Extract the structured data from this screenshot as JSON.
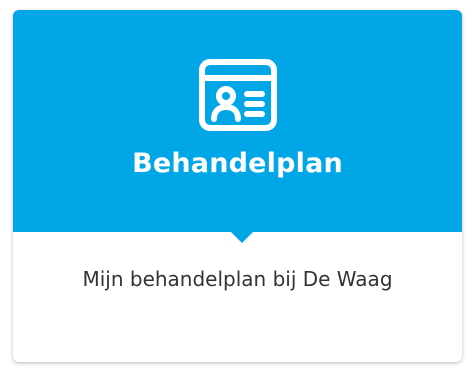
{
  "card": {
    "title": "Behandelplan",
    "description": "Mijn behandelplan bij De Waag",
    "icon": "treatment-plan-id-card-icon",
    "accent_color": "#00a6e6"
  }
}
